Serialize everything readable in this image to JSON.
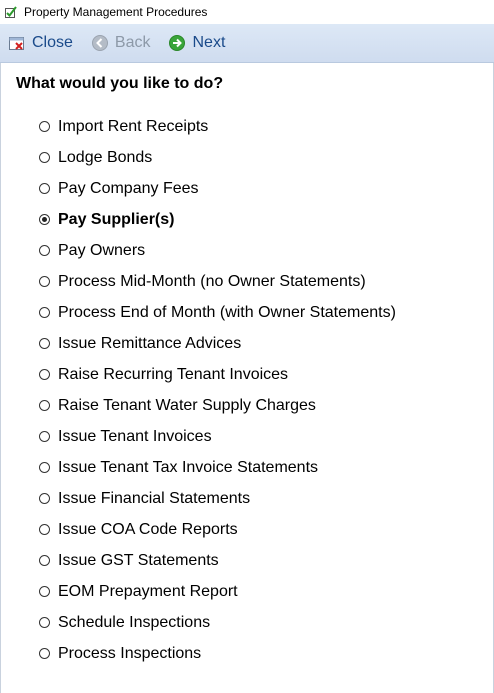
{
  "window": {
    "title": "Property Management Procedures"
  },
  "toolbar": {
    "close_label": "Close",
    "back_label": "Back",
    "next_label": "Next"
  },
  "main": {
    "question": "What would you like to do?",
    "selected_index": 3,
    "options": [
      "Import Rent Receipts",
      "Lodge Bonds",
      "Pay Company Fees",
      "Pay Supplier(s)",
      "Pay Owners",
      "Process Mid-Month (no Owner Statements)",
      "Process End of Month (with Owner Statements)",
      "Issue Remittance Advices",
      "Raise Recurring Tenant Invoices",
      "Raise Tenant Water Supply Charges",
      "Issue Tenant Invoices",
      "Issue Tenant Tax Invoice Statements",
      "Issue Financial Statements",
      "Issue COA Code Reports",
      "Issue GST Statements",
      "EOM Prepayment Report",
      "Schedule Inspections",
      "Process Inspections"
    ]
  },
  "colors": {
    "toolbar_bg": "#d6e2f2",
    "link_text": "#1a4a8a",
    "disabled_text": "#8d99a8",
    "next_icon": "#3aa53a",
    "close_icon_x": "#d12020"
  }
}
